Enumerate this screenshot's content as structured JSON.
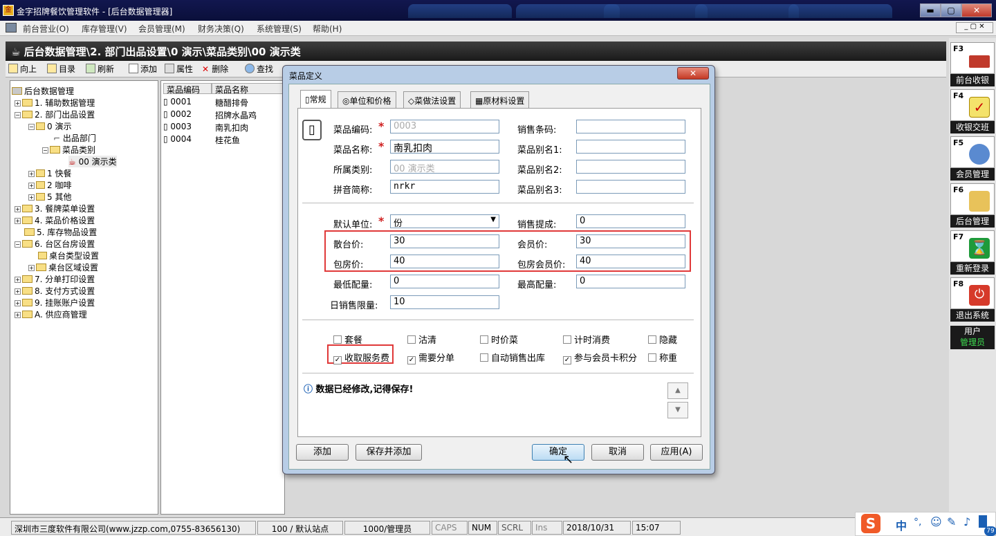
{
  "window": {
    "title": "金字招牌餐饮管理软件 - [后台数据管理器]",
    "min": "▬",
    "max": "▢",
    "close": "✕"
  },
  "menu": [
    "前台营业(O)",
    "库存管理(V)",
    "会员管理(M)",
    "财务决策(Q)",
    "系统管理(S)",
    "帮助(H)"
  ],
  "breadcrumb": "后台数据管理\\2. 部门出品设置\\0 演示\\菜品类别\\00 演示类",
  "toolbar": [
    "向上",
    "目录",
    "刷新",
    "添加",
    "属性",
    "删除",
    "查找"
  ],
  "tree": [
    {
      "t": "后台数据管理"
    },
    {
      "t": "1. 辅助数据管理"
    },
    {
      "t": "2. 部门出品设置"
    },
    {
      "t": "0 演示"
    },
    {
      "t": "出品部门"
    },
    {
      "t": "菜品类别"
    },
    {
      "t": "00 演示类"
    },
    {
      "t": "1 快餐"
    },
    {
      "t": "2 咖啡"
    },
    {
      "t": "5 其他"
    },
    {
      "t": "3. 餐牌菜单设置"
    },
    {
      "t": "4. 菜品价格设置"
    },
    {
      "t": "5. 库存物品设置"
    },
    {
      "t": "6. 台区台房设置"
    },
    {
      "t": "桌台类型设置"
    },
    {
      "t": "桌台区域设置"
    },
    {
      "t": "7. 分单打印设置"
    },
    {
      "t": "8. 支付方式设置"
    },
    {
      "t": "9. 挂账账户设置"
    },
    {
      "t": "A. 供应商管理"
    }
  ],
  "list": {
    "headers": [
      "菜品编码",
      "菜品名称"
    ],
    "rows": [
      [
        "0001",
        "糖醋排骨"
      ],
      [
        "0002",
        "招牌水晶鸡"
      ],
      [
        "0003",
        "南乳扣肉"
      ],
      [
        "0004",
        "桂花鱼"
      ]
    ]
  },
  "side": {
    "keys": [
      "F3",
      "F4",
      "F5",
      "F6",
      "F7",
      "F8"
    ],
    "labels": [
      "前台收银",
      "收银交班",
      "会员管理",
      "后台管理",
      "重新登录",
      "退出系统"
    ],
    "user_label": "用户",
    "user_name": "管理员"
  },
  "dialog": {
    "title": "菜品定义",
    "close": "✕",
    "tabs": [
      "常规",
      "单位和价格",
      "菜做法设置",
      "原材料设置"
    ],
    "labels": {
      "code": "菜品编码:",
      "name": "菜品名称:",
      "category": "所属类别:",
      "pinyin": "拼音简称:",
      "barcode": "销售条码:",
      "alias1": "菜品别名1:",
      "alias2": "菜品别名2:",
      "alias3": "菜品别名3:",
      "unit": "默认单位:",
      "commission": "销售提成:",
      "price_hall": "散台价:",
      "price_member": "会员价:",
      "price_room": "包房价:",
      "price_room_member": "包房会员价:",
      "min_stock": "最低配量:",
      "max_stock": "最高配量:",
      "daily_limit": "日销售限量:"
    },
    "values": {
      "code": "0003",
      "name": "南乳扣肉",
      "category": "00 演示类",
      "pinyin": "nrkr",
      "barcode": "",
      "alias1": "",
      "alias2": "",
      "alias3": "",
      "unit": "份",
      "commission": "0",
      "price_hall": "30",
      "price_member": "30",
      "price_room": "40",
      "price_room_member": "40",
      "min_stock": "0",
      "max_stock": "0",
      "daily_limit": "10"
    },
    "star": "*",
    "checkboxes": [
      {
        "label": "套餐",
        "checked": false
      },
      {
        "label": "沽清",
        "checked": false
      },
      {
        "label": "时价菜",
        "checked": false
      },
      {
        "label": "计时消费",
        "checked": false
      },
      {
        "label": "隐藏",
        "checked": false
      },
      {
        "label": "收取服务费",
        "checked": true
      },
      {
        "label": "需要分单",
        "checked": true
      },
      {
        "label": "自动销售出库",
        "checked": false
      },
      {
        "label": "参与会员卡积分",
        "checked": true
      },
      {
        "label": "称重",
        "checked": false
      }
    ],
    "notice": "数据已经修改,记得保存!",
    "buttons": {
      "add": "添加",
      "save_add": "保存并添加",
      "ok": "确定",
      "cancel": "取消",
      "apply": "应用(A)"
    }
  },
  "status": [
    "深圳市三度软件有限公司(www.jzzp.com,0755-83656130)",
    "100 / 默认站点",
    "1000/管理员",
    "CAPS",
    "NUM",
    "SCRL",
    "Ins",
    "2018/10/31",
    "15:07"
  ],
  "ime": {
    "logo": "S",
    "mode": "中",
    "badge": "79"
  }
}
